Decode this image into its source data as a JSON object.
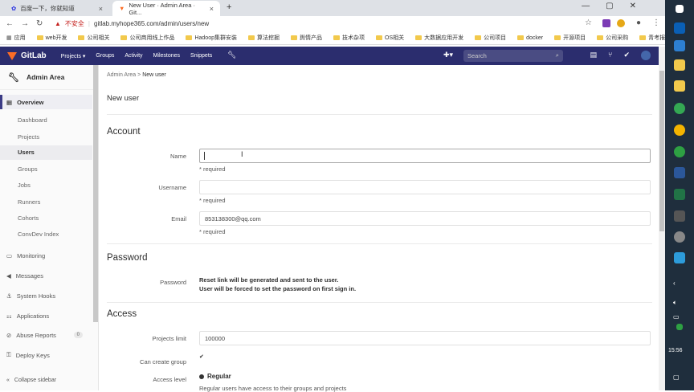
{
  "browser": {
    "tabs": [
      {
        "title": "百度一下，你就知道"
      },
      {
        "title": "New User · Admin Area · Git..."
      }
    ],
    "insecure": "不安全",
    "url": "gitlab.myhope365.com/admin/users/new",
    "bookmarks": [
      "应用",
      "web开发",
      "公司相关",
      "公司商用线上作品",
      "Hadoop集群安装",
      "算法挖掘",
      "舆情产品",
      "技术杂项",
      "OS相关",
      "大数据应用开发",
      "公司项目",
      "docker",
      "开源项目",
      "公司采购",
      "青考报名"
    ]
  },
  "gitlab": {
    "brand": "GitLab",
    "nav": [
      "Projects ▾",
      "Groups",
      "Activity",
      "Milestones",
      "Snippets"
    ],
    "search_placeholder": "Search"
  },
  "sidebar": {
    "title": "Admin Area",
    "overview": "Overview",
    "sub": [
      "Dashboard",
      "Projects",
      "Users",
      "Groups",
      "Jobs",
      "Runners",
      "Cohorts",
      "ConvDev Index"
    ],
    "items": [
      "Monitoring",
      "Messages",
      "System Hooks",
      "Applications",
      "Abuse Reports",
      "Deploy Keys"
    ],
    "abuse_count": "0",
    "collapse": "Collapse sidebar"
  },
  "main": {
    "breadcrumb_root": "Admin Area",
    "breadcrumb_sep": ">",
    "breadcrumb_current": "New user",
    "page_title": "New user",
    "account": "Account",
    "name_label": "Name",
    "name_value": "",
    "required": "* required",
    "username_label": "Username",
    "username_value": "",
    "email_label": "Email",
    "email_value": "853138300@qq.com",
    "password_section": "Password",
    "password_label": "Password",
    "password_line1": "Reset link will be generated and sent to the user.",
    "password_line2": "User will be forced to set the password on first sign in.",
    "access_section": "Access",
    "projects_limit_label": "Projects limit",
    "projects_limit_value": "100000",
    "can_create_group_label": "Can create group",
    "can_create_group_checked": true,
    "access_level_label": "Access level",
    "access_level_value": "Regular",
    "access_level_help": "Regular users have access to their groups and projects"
  },
  "taskbar": {
    "time": "15:56"
  },
  "colors": {
    "header": "#2b2d6e",
    "accent": "#fc6d26",
    "active": "#3b3b85"
  }
}
